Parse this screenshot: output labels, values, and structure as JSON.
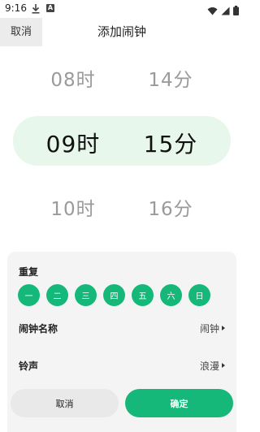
{
  "status_bar": {
    "time": "9:16",
    "notification_badge": "A"
  },
  "header": {
    "cancel_label": "取消",
    "title": "添加闹钟"
  },
  "picker": {
    "hours": [
      "08时",
      "09时",
      "10时"
    ],
    "minutes": [
      "14分",
      "15分",
      "16分"
    ],
    "selected_hour": "09时",
    "selected_minute": "15分"
  },
  "repeat": {
    "label": "重复",
    "days": [
      "一",
      "二",
      "三",
      "四",
      "五",
      "六",
      "日"
    ]
  },
  "settings": {
    "alarm_name_label": "闹钟名称",
    "alarm_name_value": "闹钟",
    "ringtone_label": "铃声",
    "ringtone_value": "浪漫"
  },
  "buttons": {
    "cancel": "取消",
    "confirm": "确定"
  },
  "colors": {
    "accent": "#16b87a",
    "selected_band": "#e8f7ec",
    "panel_bg": "#f4f4f4"
  }
}
